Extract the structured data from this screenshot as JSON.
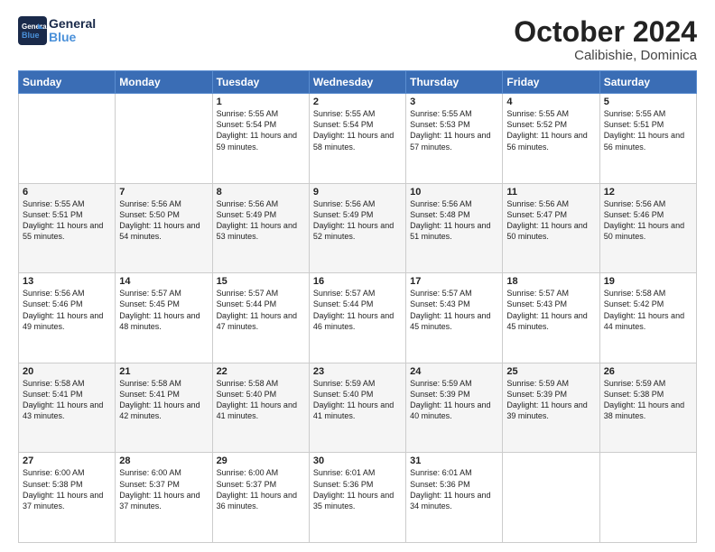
{
  "header": {
    "logo_line1": "General",
    "logo_line2": "Blue",
    "month": "October 2024",
    "location": "Calibishie, Dominica"
  },
  "days_of_week": [
    "Sunday",
    "Monday",
    "Tuesday",
    "Wednesday",
    "Thursday",
    "Friday",
    "Saturday"
  ],
  "weeks": [
    [
      {
        "day": "",
        "sunrise": "",
        "sunset": "",
        "daylight": ""
      },
      {
        "day": "",
        "sunrise": "",
        "sunset": "",
        "daylight": ""
      },
      {
        "day": "1",
        "sunrise": "Sunrise: 5:55 AM",
        "sunset": "Sunset: 5:54 PM",
        "daylight": "Daylight: 11 hours and 59 minutes."
      },
      {
        "day": "2",
        "sunrise": "Sunrise: 5:55 AM",
        "sunset": "Sunset: 5:54 PM",
        "daylight": "Daylight: 11 hours and 58 minutes."
      },
      {
        "day": "3",
        "sunrise": "Sunrise: 5:55 AM",
        "sunset": "Sunset: 5:53 PM",
        "daylight": "Daylight: 11 hours and 57 minutes."
      },
      {
        "day": "4",
        "sunrise": "Sunrise: 5:55 AM",
        "sunset": "Sunset: 5:52 PM",
        "daylight": "Daylight: 11 hours and 56 minutes."
      },
      {
        "day": "5",
        "sunrise": "Sunrise: 5:55 AM",
        "sunset": "Sunset: 5:51 PM",
        "daylight": "Daylight: 11 hours and 56 minutes."
      }
    ],
    [
      {
        "day": "6",
        "sunrise": "Sunrise: 5:55 AM",
        "sunset": "Sunset: 5:51 PM",
        "daylight": "Daylight: 11 hours and 55 minutes."
      },
      {
        "day": "7",
        "sunrise": "Sunrise: 5:56 AM",
        "sunset": "Sunset: 5:50 PM",
        "daylight": "Daylight: 11 hours and 54 minutes."
      },
      {
        "day": "8",
        "sunrise": "Sunrise: 5:56 AM",
        "sunset": "Sunset: 5:49 PM",
        "daylight": "Daylight: 11 hours and 53 minutes."
      },
      {
        "day": "9",
        "sunrise": "Sunrise: 5:56 AM",
        "sunset": "Sunset: 5:49 PM",
        "daylight": "Daylight: 11 hours and 52 minutes."
      },
      {
        "day": "10",
        "sunrise": "Sunrise: 5:56 AM",
        "sunset": "Sunset: 5:48 PM",
        "daylight": "Daylight: 11 hours and 51 minutes."
      },
      {
        "day": "11",
        "sunrise": "Sunrise: 5:56 AM",
        "sunset": "Sunset: 5:47 PM",
        "daylight": "Daylight: 11 hours and 50 minutes."
      },
      {
        "day": "12",
        "sunrise": "Sunrise: 5:56 AM",
        "sunset": "Sunset: 5:46 PM",
        "daylight": "Daylight: 11 hours and 50 minutes."
      }
    ],
    [
      {
        "day": "13",
        "sunrise": "Sunrise: 5:56 AM",
        "sunset": "Sunset: 5:46 PM",
        "daylight": "Daylight: 11 hours and 49 minutes."
      },
      {
        "day": "14",
        "sunrise": "Sunrise: 5:57 AM",
        "sunset": "Sunset: 5:45 PM",
        "daylight": "Daylight: 11 hours and 48 minutes."
      },
      {
        "day": "15",
        "sunrise": "Sunrise: 5:57 AM",
        "sunset": "Sunset: 5:44 PM",
        "daylight": "Daylight: 11 hours and 47 minutes."
      },
      {
        "day": "16",
        "sunrise": "Sunrise: 5:57 AM",
        "sunset": "Sunset: 5:44 PM",
        "daylight": "Daylight: 11 hours and 46 minutes."
      },
      {
        "day": "17",
        "sunrise": "Sunrise: 5:57 AM",
        "sunset": "Sunset: 5:43 PM",
        "daylight": "Daylight: 11 hours and 45 minutes."
      },
      {
        "day": "18",
        "sunrise": "Sunrise: 5:57 AM",
        "sunset": "Sunset: 5:43 PM",
        "daylight": "Daylight: 11 hours and 45 minutes."
      },
      {
        "day": "19",
        "sunrise": "Sunrise: 5:58 AM",
        "sunset": "Sunset: 5:42 PM",
        "daylight": "Daylight: 11 hours and 44 minutes."
      }
    ],
    [
      {
        "day": "20",
        "sunrise": "Sunrise: 5:58 AM",
        "sunset": "Sunset: 5:41 PM",
        "daylight": "Daylight: 11 hours and 43 minutes."
      },
      {
        "day": "21",
        "sunrise": "Sunrise: 5:58 AM",
        "sunset": "Sunset: 5:41 PM",
        "daylight": "Daylight: 11 hours and 42 minutes."
      },
      {
        "day": "22",
        "sunrise": "Sunrise: 5:58 AM",
        "sunset": "Sunset: 5:40 PM",
        "daylight": "Daylight: 11 hours and 41 minutes."
      },
      {
        "day": "23",
        "sunrise": "Sunrise: 5:59 AM",
        "sunset": "Sunset: 5:40 PM",
        "daylight": "Daylight: 11 hours and 41 minutes."
      },
      {
        "day": "24",
        "sunrise": "Sunrise: 5:59 AM",
        "sunset": "Sunset: 5:39 PM",
        "daylight": "Daylight: 11 hours and 40 minutes."
      },
      {
        "day": "25",
        "sunrise": "Sunrise: 5:59 AM",
        "sunset": "Sunset: 5:39 PM",
        "daylight": "Daylight: 11 hours and 39 minutes."
      },
      {
        "day": "26",
        "sunrise": "Sunrise: 5:59 AM",
        "sunset": "Sunset: 5:38 PM",
        "daylight": "Daylight: 11 hours and 38 minutes."
      }
    ],
    [
      {
        "day": "27",
        "sunrise": "Sunrise: 6:00 AM",
        "sunset": "Sunset: 5:38 PM",
        "daylight": "Daylight: 11 hours and 37 minutes."
      },
      {
        "day": "28",
        "sunrise": "Sunrise: 6:00 AM",
        "sunset": "Sunset: 5:37 PM",
        "daylight": "Daylight: 11 hours and 37 minutes."
      },
      {
        "day": "29",
        "sunrise": "Sunrise: 6:00 AM",
        "sunset": "Sunset: 5:37 PM",
        "daylight": "Daylight: 11 hours and 36 minutes."
      },
      {
        "day": "30",
        "sunrise": "Sunrise: 6:01 AM",
        "sunset": "Sunset: 5:36 PM",
        "daylight": "Daylight: 11 hours and 35 minutes."
      },
      {
        "day": "31",
        "sunrise": "Sunrise: 6:01 AM",
        "sunset": "Sunset: 5:36 PM",
        "daylight": "Daylight: 11 hours and 34 minutes."
      },
      {
        "day": "",
        "sunrise": "",
        "sunset": "",
        "daylight": ""
      },
      {
        "day": "",
        "sunrise": "",
        "sunset": "",
        "daylight": ""
      }
    ]
  ]
}
